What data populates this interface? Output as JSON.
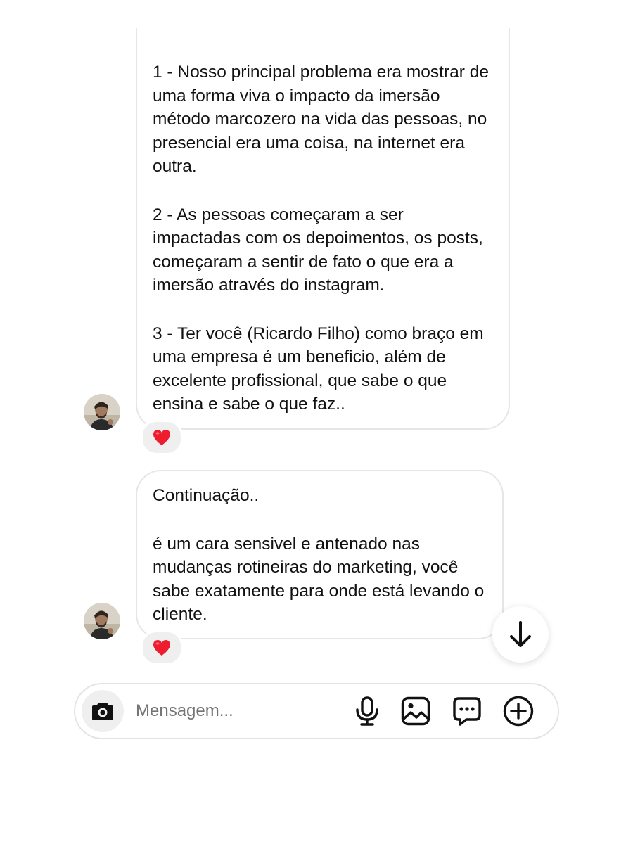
{
  "messages": [
    {
      "paragraphs": [
        "1 - Nosso principal problema era mostrar de uma forma viva o impacto da imersão método marcozero na vida das pessoas, no presencial era uma coisa, na internet era outra.",
        "2 - As pessoas começaram a ser impactadas com os depoimentos, os posts, começaram a sentir de fato o que era a imersão através do instagram.",
        "3 - Ter você (Ricardo Filho) como braço em uma empresa é um beneficio, além de excelente profissional, que sabe o que ensina e sabe o que faz.."
      ],
      "reaction": "❤️"
    },
    {
      "paragraphs": [
        "Continuação..",
        "é um cara sensivel e antenado nas mudanças rotineiras do marketing, você sabe exatamente para onde está levando o cliente."
      ],
      "reaction": "❤️"
    }
  ],
  "composer": {
    "placeholder": "Mensagem..."
  },
  "icons": {
    "camera": "camera-icon",
    "microphone": "microphone-icon",
    "gallery": "gallery-icon",
    "sticker": "sticker-chat-icon",
    "plus": "plus-circle-icon",
    "scroll": "arrow-down-icon",
    "heart": "heart-icon"
  },
  "colors": {
    "bubble_border": "#e6e6e6",
    "reaction_bg": "#efefef",
    "placeholder": "#737373",
    "heart": "#ed1c2e"
  }
}
